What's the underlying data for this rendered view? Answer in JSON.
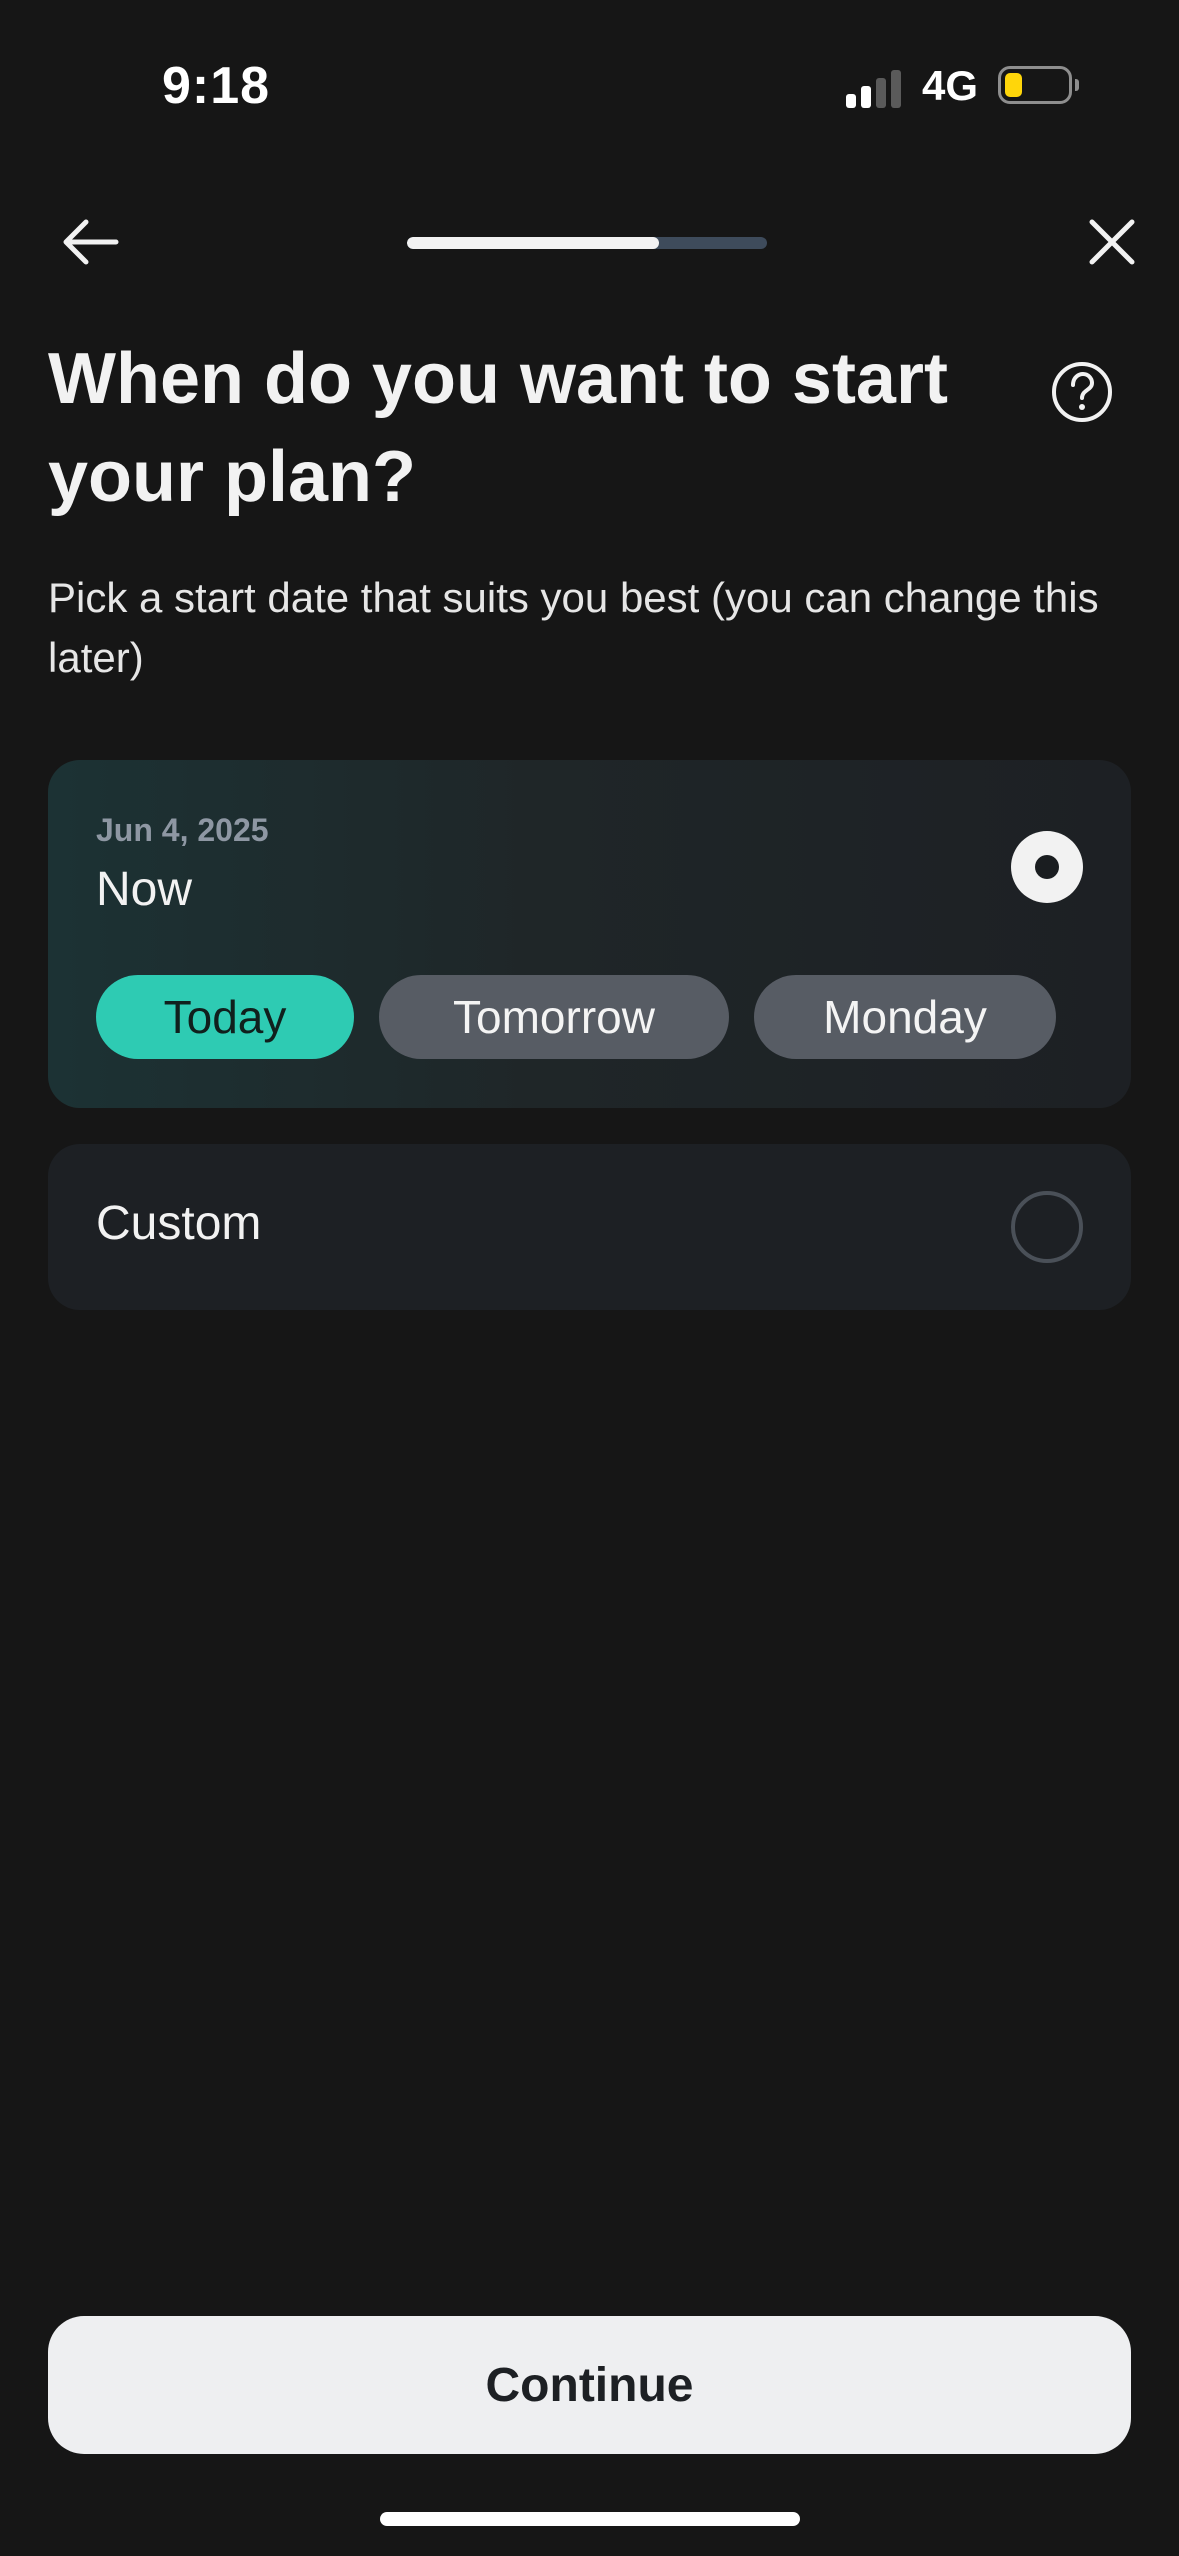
{
  "status_bar": {
    "time": "9:18",
    "network": "4G",
    "signal_bars_active": 2,
    "signal_bars_total": 4,
    "battery_level": 0.2,
    "battery_color": "#ffd60a"
  },
  "header": {
    "progress_fraction": 0.7
  },
  "content": {
    "title": "When do you want to start your plan?",
    "subtitle": "Pick a start date that suits you best (you can change this later)"
  },
  "options": {
    "now": {
      "date": "Jun 4, 2025",
      "label": "Now",
      "selected": true,
      "chips": [
        {
          "label": "Today",
          "selected": true
        },
        {
          "label": "Tomorrow",
          "selected": false
        },
        {
          "label": "Monday",
          "selected": false
        }
      ]
    },
    "custom": {
      "label": "Custom",
      "selected": false
    }
  },
  "footer": {
    "continue_label": "Continue"
  },
  "icons": {
    "back": "arrow-left-icon",
    "close": "close-icon",
    "help": "question-circle-icon"
  },
  "colors": {
    "background": "#161616",
    "accent": "#2ecbb3",
    "chip_inactive": "#575c64",
    "progress_track": "#3e4b5b"
  }
}
